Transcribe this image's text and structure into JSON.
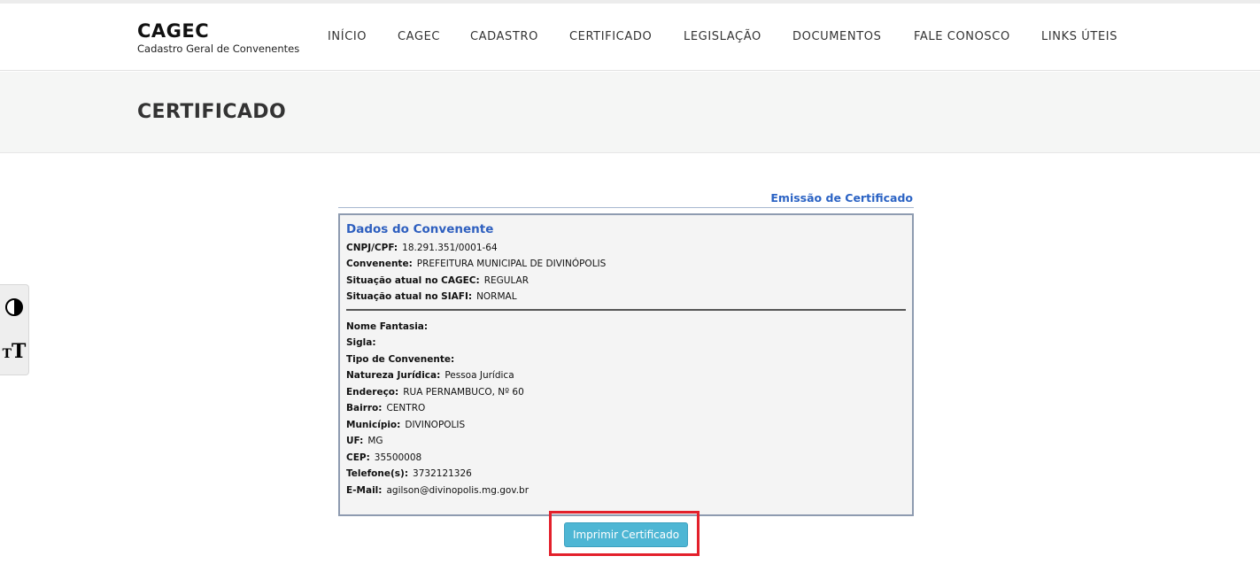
{
  "brand": {
    "title": "CAGEC",
    "subtitle": "Cadastro Geral de Convenentes"
  },
  "nav": [
    {
      "label": "INÍCIO"
    },
    {
      "label": "CAGEC"
    },
    {
      "label": "CADASTRO"
    },
    {
      "label": "CERTIFICADO"
    },
    {
      "label": "LEGISLAÇÃO"
    },
    {
      "label": "DOCUMENTOS"
    },
    {
      "label": "FALE CONOSCO"
    },
    {
      "label": "LINKS ÚTEIS"
    }
  ],
  "page_title": "CERTIFICADO",
  "accessibility": {
    "contrast_icon": "contrast-icon",
    "font_size_icon": "font-size-icon"
  },
  "emissao_label": "Emissão de Certificado",
  "panel": {
    "title": "Dados do Convenente",
    "summary": [
      {
        "label": "CNPJ/CPF:",
        "value": "18.291.351/0001-64"
      },
      {
        "label": "Convenente:",
        "value": "PREFEITURA MUNICIPAL DE DIVINÓPOLIS"
      },
      {
        "label": "Situação atual no CAGEC:",
        "value": "REGULAR"
      },
      {
        "label": "Situação atual no SIAFI:",
        "value": "NORMAL"
      }
    ],
    "details": [
      {
        "label": "Nome Fantasia:",
        "value": ""
      },
      {
        "label": "Sigla:",
        "value": ""
      },
      {
        "label": "Tipo de Convenente:",
        "value": ""
      },
      {
        "label": "Natureza Jurídica:",
        "value": "Pessoa Jurídica"
      },
      {
        "label": "Endereço:",
        "value": "RUA PERNAMBUCO, Nº 60"
      },
      {
        "label": "Bairro:",
        "value": "CENTRO"
      },
      {
        "label": "Município:",
        "value": "DIVINOPOLIS"
      },
      {
        "label": "UF:",
        "value": "MG"
      },
      {
        "label": "CEP:",
        "value": "35500008"
      },
      {
        "label": "Telefone(s):",
        "value": "3732121326"
      },
      {
        "label": "E-Mail:",
        "value": "agilson@divinopolis.mg.gov.br"
      }
    ]
  },
  "print_button": "Imprimir Certificado",
  "colors": {
    "accent_blue": "#2e5fbf",
    "button": "#4eb6d4",
    "highlight": "#e3202b"
  }
}
